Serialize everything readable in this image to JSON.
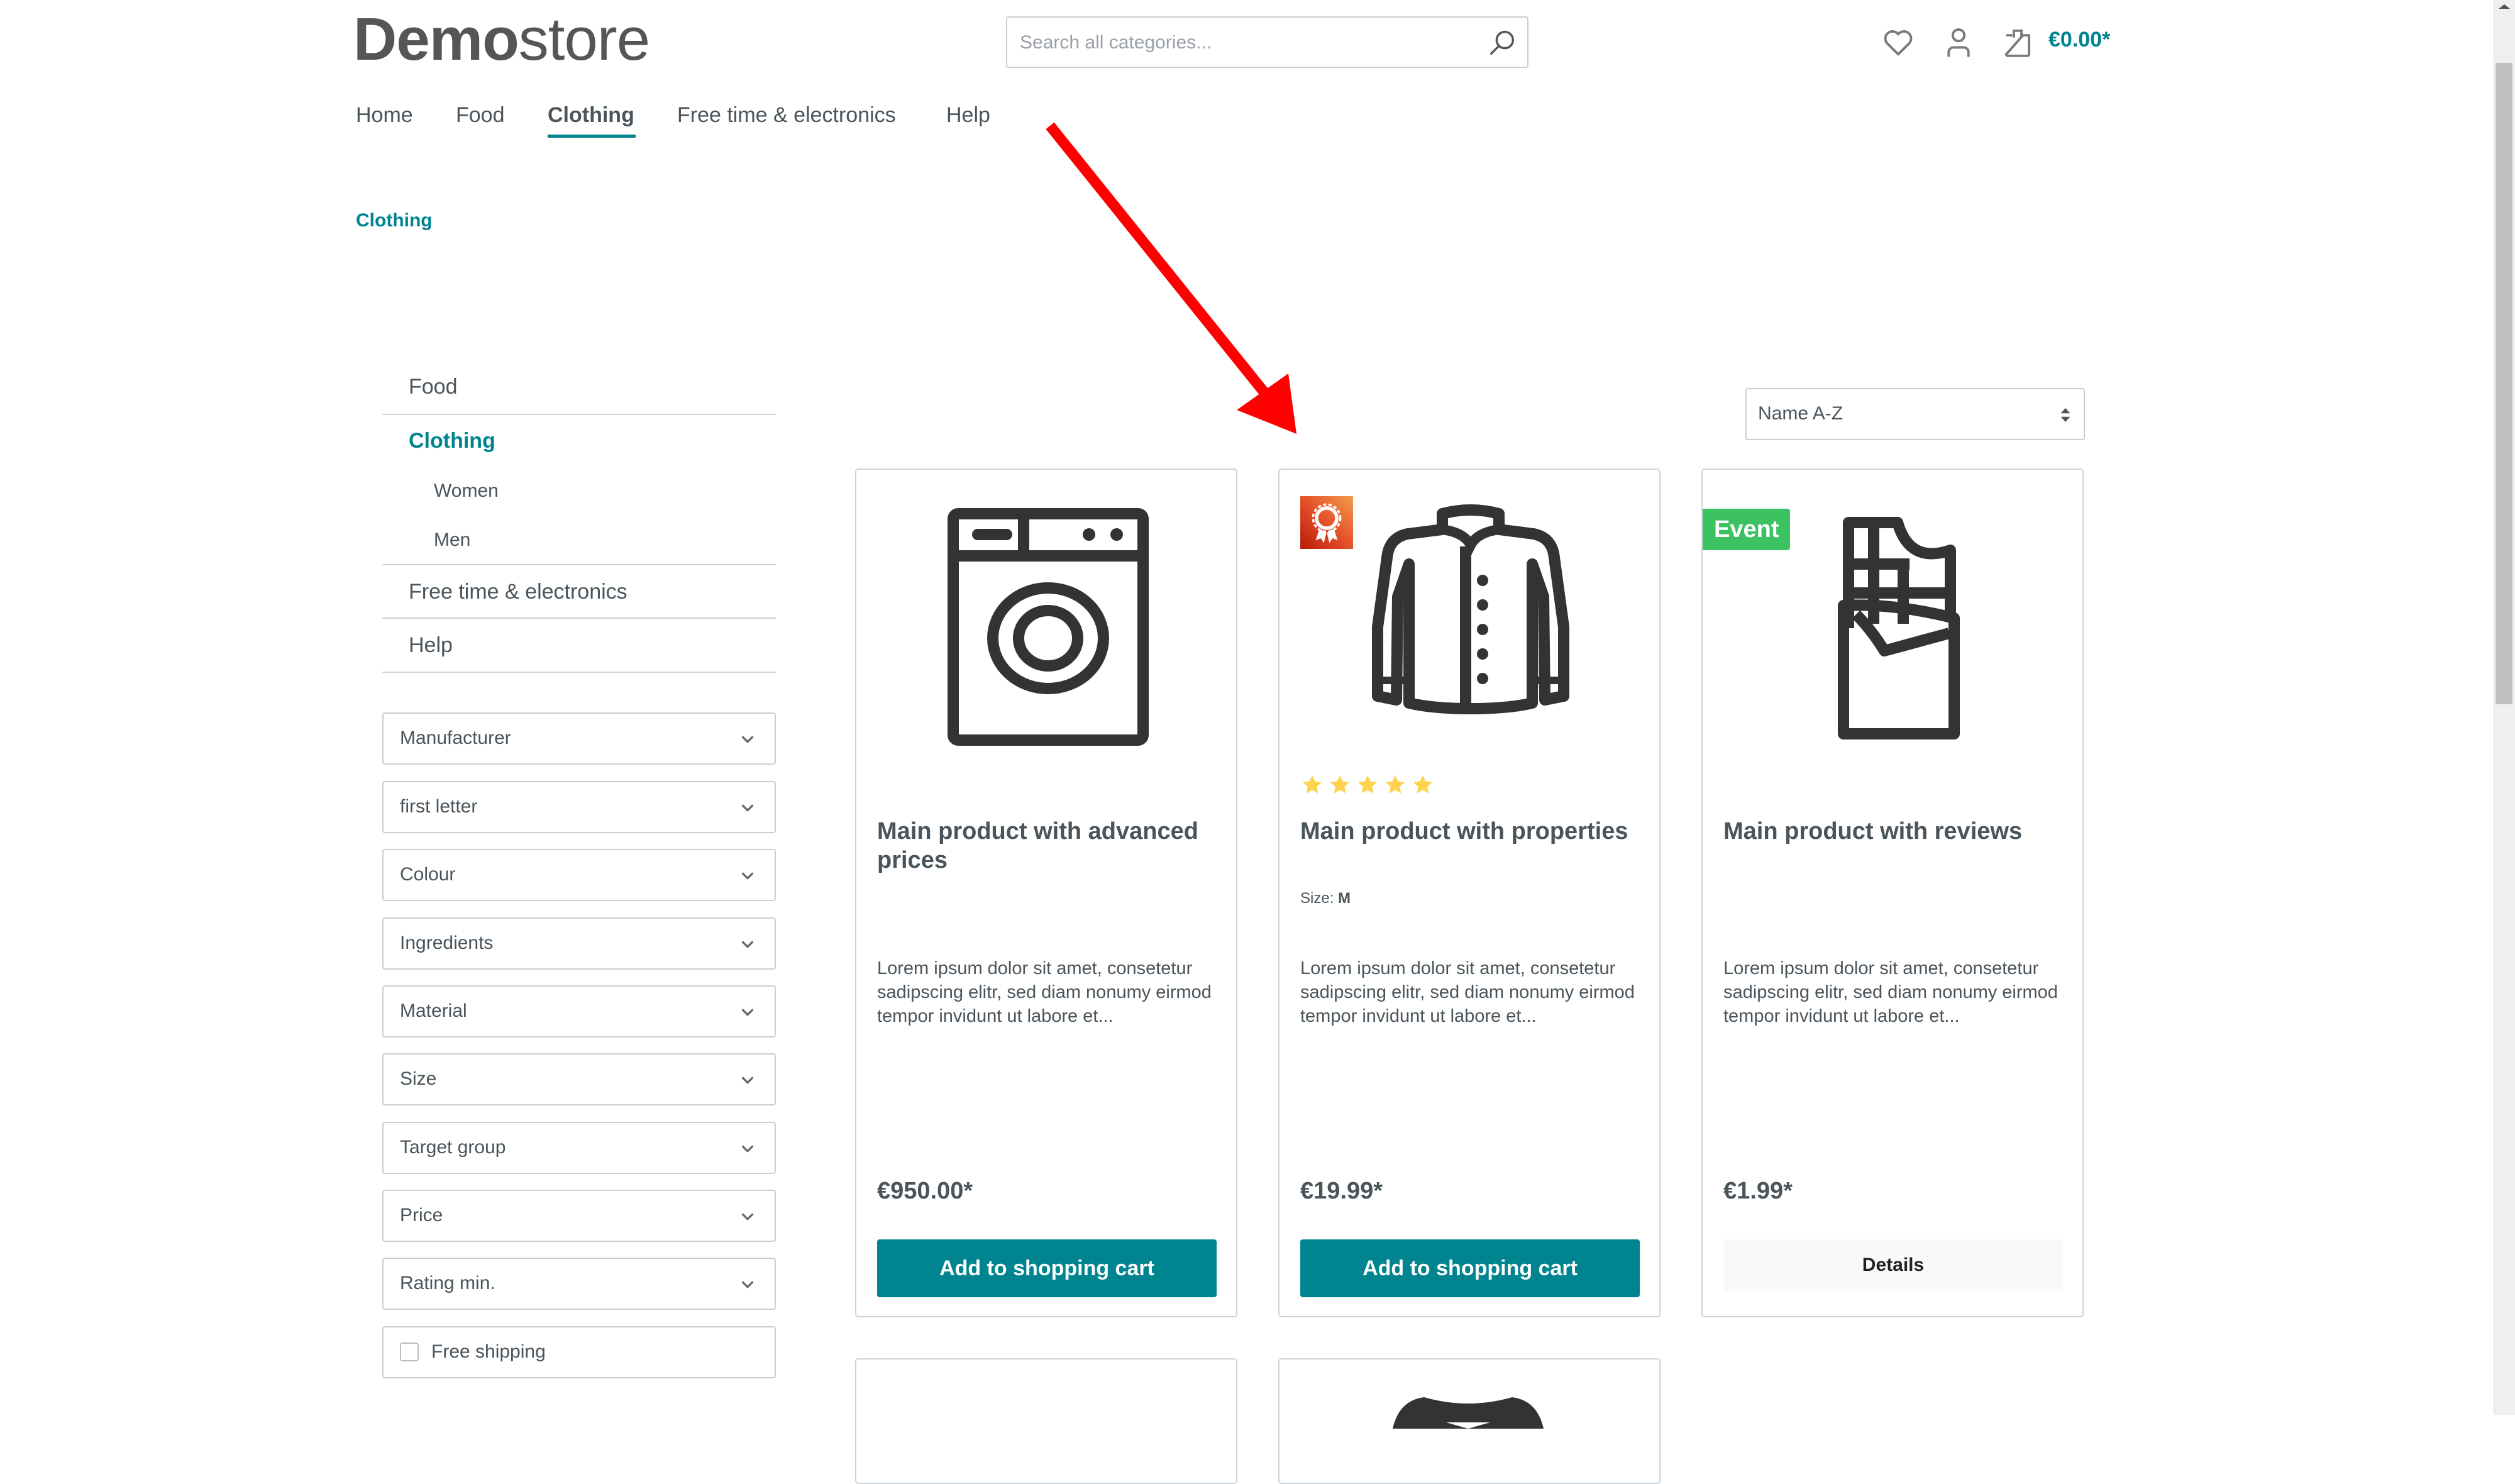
{
  "header": {
    "logo_bold": "Demo",
    "logo_light": "store",
    "search_placeholder": "Search all categories...",
    "cart_total": "€0.00*",
    "icons": [
      "heart-icon",
      "user-icon",
      "shopping-bag-icon",
      "search-icon"
    ]
  },
  "nav": {
    "items": [
      {
        "label": "Home",
        "active": false
      },
      {
        "label": "Food",
        "active": false
      },
      {
        "label": "Clothing",
        "active": true
      },
      {
        "label": "Free time & electronics",
        "active": false
      },
      {
        "label": "Help",
        "active": false
      }
    ]
  },
  "breadcrumb": {
    "current": "Clothing"
  },
  "sidebar": {
    "categories": [
      {
        "label": "Food",
        "active": false
      },
      {
        "label": "Clothing",
        "active": true,
        "children": [
          {
            "label": "Women"
          },
          {
            "label": "Men"
          }
        ]
      },
      {
        "label": "Free time & electronics",
        "active": false
      },
      {
        "label": "Help",
        "active": false
      }
    ],
    "filters": [
      {
        "label": "Manufacturer"
      },
      {
        "label": "first letter"
      },
      {
        "label": "Colour"
      },
      {
        "label": "Ingredients"
      },
      {
        "label": "Material"
      },
      {
        "label": "Size"
      },
      {
        "label": "Target group"
      },
      {
        "label": "Price"
      },
      {
        "label": "Rating min."
      }
    ],
    "free_shipping": {
      "label": "Free shipping",
      "checked": false
    }
  },
  "sort": {
    "selected": "Name A-Z"
  },
  "products": [
    {
      "title": "Main product with advanced prices",
      "image": "washing-machine-icon",
      "description": "Lorem ipsum dolor sit amet, consetetur sadipscing elitr, sed diam nonumy eirmod tempor invidunt ut labore et...",
      "price": "€950.00*",
      "action": "Add to shopping cart"
    },
    {
      "title": "Main product with properties",
      "image": "jacket-icon",
      "badge": "topseller-award-icon",
      "rating": 5,
      "rating_max": 5,
      "property_label": "Size:",
      "property_value": "M",
      "description": "Lorem ipsum dolor sit amet, consetetur sadipscing elitr, sed diam nonumy eirmod tempor invidunt ut labore et...",
      "price": "€19.99*",
      "action": "Add to shopping cart"
    },
    {
      "title": "Main product with reviews",
      "image": "chocolate-bar-icon",
      "badge_text": "Event",
      "description": "Lorem ipsum dolor sit amet, consetetur sadipscing elitr, sed diam nonumy eirmod tempor invidunt ut labore et...",
      "price": "€1.99*",
      "action": "Details"
    }
  ],
  "colors": {
    "accent": "#008490",
    "event_badge": "#3cc261",
    "star": "#ffd350",
    "annotation_arrow": "#ff0000"
  }
}
